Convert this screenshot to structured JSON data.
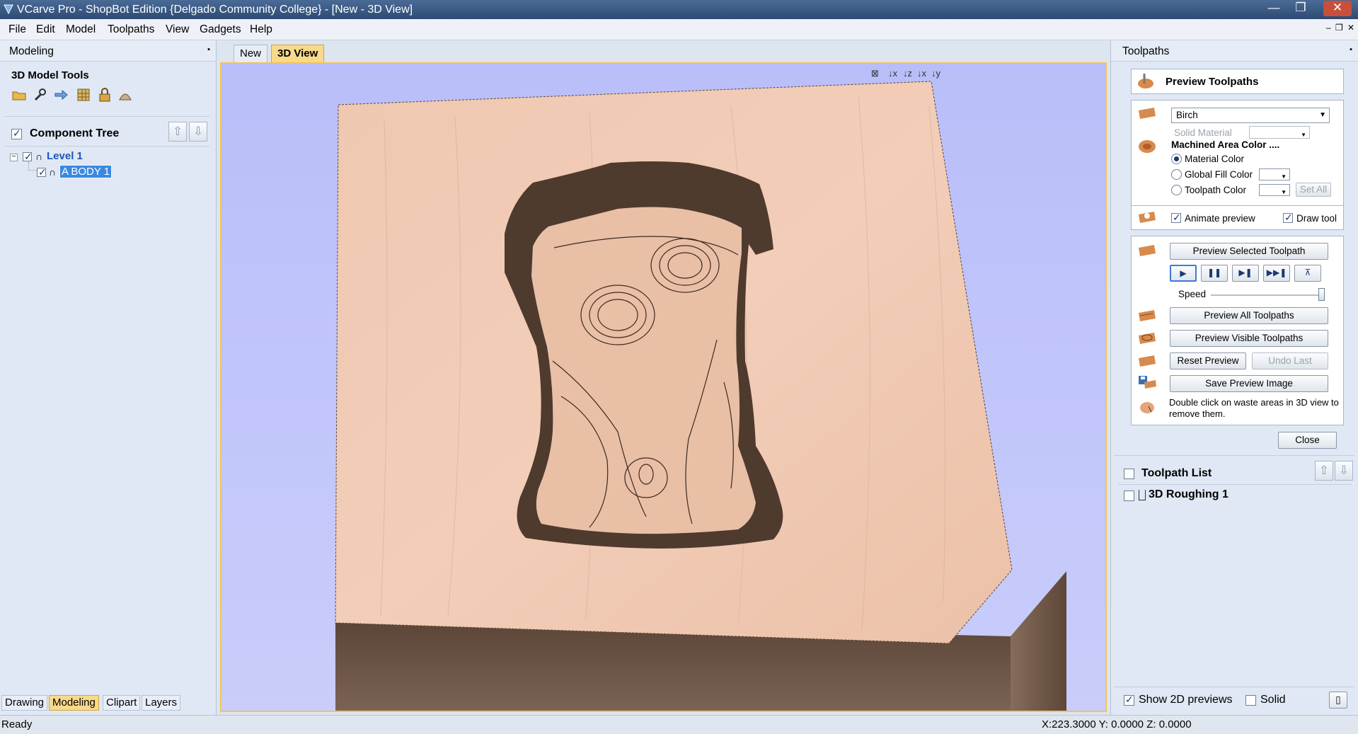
{
  "window": {
    "title": "VCarve Pro - ShopBot Edition {Delgado Community College} - [New - 3D View]",
    "controls": [
      "—",
      "❐",
      "✕"
    ]
  },
  "menu": [
    "File",
    "Edit",
    "Model",
    "Toolpaths",
    "View",
    "Gadgets",
    "Help"
  ],
  "mdi_controls": [
    "–",
    "❐",
    "✕"
  ],
  "left_panel": {
    "title": "Modeling",
    "section": "3D Model Tools",
    "component_tree": {
      "title": "Component Tree",
      "level": "Level 1",
      "item": "A BODY 1"
    },
    "tabs": [
      "Drawing",
      "Modeling",
      "Clipart",
      "Layers"
    ],
    "active_tab": "Modeling"
  },
  "center": {
    "tabs": [
      "New",
      "3D View"
    ],
    "active_tab": "3D View",
    "view_icons": [
      "⊠",
      "↓x",
      "↓z",
      "↓x",
      "↓y"
    ]
  },
  "right_panel": {
    "title": "Toolpaths",
    "header": "Preview Toolpaths",
    "material": "Birch",
    "solid_material_label": "Solid Material",
    "machined_area_label": "Machined Area Color ....",
    "color_options": [
      "Material Color",
      "Global Fill Color",
      "Toolpath Color"
    ],
    "set_all": "Set All",
    "animate_preview": "Animate preview",
    "draw_tool": "Draw tool",
    "preview_selected": "Preview Selected Toolpath",
    "speed_label": "Speed",
    "preview_all": "Preview All Toolpaths",
    "preview_visible": "Preview Visible Toolpaths",
    "reset_preview": "Reset Preview",
    "undo_last": "Undo Last",
    "save_preview": "Save Preview Image",
    "hint": "Double click on waste areas in 3D view to remove them.",
    "close": "Close",
    "toolpath_list_title": "Toolpath List",
    "toolpaths": [
      "3D Roughing 1"
    ],
    "show_2d_previews": "Show 2D previews",
    "solid": "Solid"
  },
  "status": {
    "left": "Ready",
    "coords": "X:223.3000 Y: 0.0000 Z: 0.0000"
  },
  "colors": {
    "wood_top": "#f0c9b3",
    "wood_side": "#6b5546",
    "background_top": "#b9bef9",
    "active_tab": "#f9d98a"
  }
}
